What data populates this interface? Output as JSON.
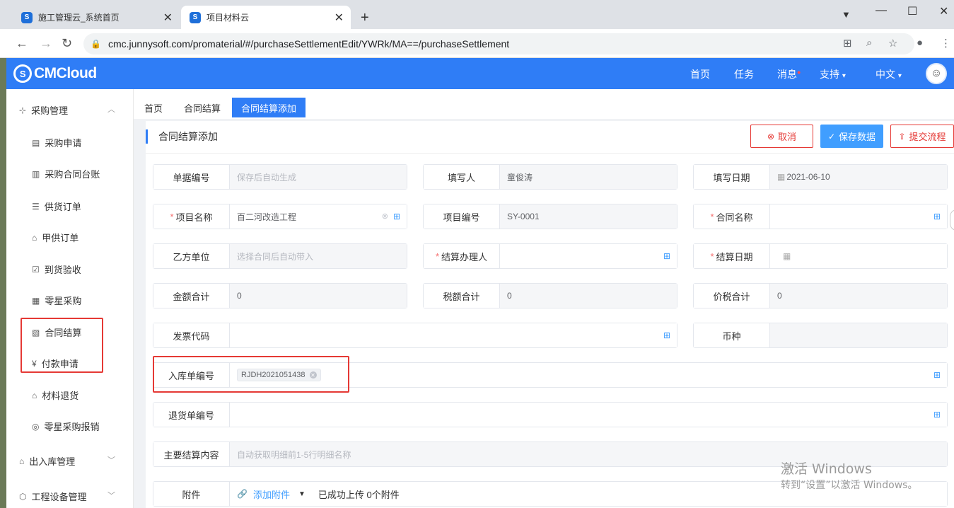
{
  "browser": {
    "tabs": [
      {
        "title": "施工管理云_系统首页",
        "active": false
      },
      {
        "title": "项目材料云",
        "active": true
      }
    ],
    "url": "cmc.junnysoft.com/promaterial/#/purchaseSettlementEdit/YWRk/MA==/purchaseSettlement"
  },
  "header": {
    "logo": "CMCloud",
    "nav": [
      "首页",
      "任务",
      "消息",
      "支持",
      "中文"
    ],
    "message_dot": "●"
  },
  "sidebar": {
    "groups": [
      {
        "label": "采购管理",
        "icon": "org-chart-icon",
        "expanded": true
      },
      {
        "label": "出入库管理",
        "icon": "warehouse-icon",
        "expanded": false
      },
      {
        "label": "工程设备管理",
        "icon": "equipment-icon",
        "expanded": false
      }
    ],
    "items": [
      {
        "label": "采购申请",
        "icon": "document-icon"
      },
      {
        "label": "采购合同台账",
        "icon": "ledger-icon"
      },
      {
        "label": "供货订单",
        "icon": "list-icon"
      },
      {
        "label": "甲供订单",
        "icon": "supply-icon"
      },
      {
        "label": "到货验收",
        "icon": "check-icon"
      },
      {
        "label": "零星采购",
        "icon": "purchase-icon"
      },
      {
        "label": "合同结算",
        "icon": "settlement-icon"
      },
      {
        "label": "付款申请",
        "icon": "yen-icon"
      },
      {
        "label": "材料退货",
        "icon": "return-icon"
      },
      {
        "label": "零星采购报销",
        "icon": "reimburse-icon"
      }
    ]
  },
  "breadcrumbs": [
    "首页",
    "合同结算",
    "合同结算添加"
  ],
  "page": {
    "title": "合同结算添加",
    "buttons": {
      "cancel": "取消",
      "save": "保存数据",
      "submit": "提交流程"
    }
  },
  "form": {
    "doc_no": {
      "label": "单据编号",
      "placeholder": "保存后自动生成"
    },
    "filled_by": {
      "label": "填写人",
      "value": "童俊涛"
    },
    "fill_date": {
      "label": "填写日期",
      "value": "2021-06-10"
    },
    "project_name": {
      "label": "项目名称",
      "value": "百二河改造工程"
    },
    "project_no": {
      "label": "项目编号",
      "value": "SY-0001"
    },
    "contract_name": {
      "label": "合同名称",
      "value": ""
    },
    "party_b": {
      "label": "乙方单位",
      "placeholder": "选择合同后自动带入"
    },
    "handler": {
      "label": "结算办理人",
      "value": ""
    },
    "settle_date": {
      "label": "结算日期",
      "value": ""
    },
    "amount_total": {
      "label": "金额合计",
      "value": "0"
    },
    "tax_total": {
      "label": "税额合计",
      "value": "0"
    },
    "price_tax_total": {
      "label": "价税合计",
      "value": "0"
    },
    "invoice_code": {
      "label": "发票代码",
      "value": ""
    },
    "currency": {
      "label": "币种",
      "value": ""
    },
    "inbound_no": {
      "label": "入库单编号",
      "tag": "RJDH2021051438"
    },
    "return_no": {
      "label": "退货单编号",
      "value": ""
    },
    "main_content": {
      "label": "主要结算内容",
      "placeholder": "自动获取明细前1-5行明细名称"
    },
    "attachment": {
      "label": "附件",
      "add_label": "添加附件",
      "status": "已成功上传 0个附件"
    }
  },
  "watermark": {
    "line1": "激活 Windows",
    "line2": "转到“设置”以激活 Windows。"
  },
  "colors": {
    "brand": "#2f7df6",
    "danger": "#e53935",
    "primary_btn": "#409eff"
  }
}
